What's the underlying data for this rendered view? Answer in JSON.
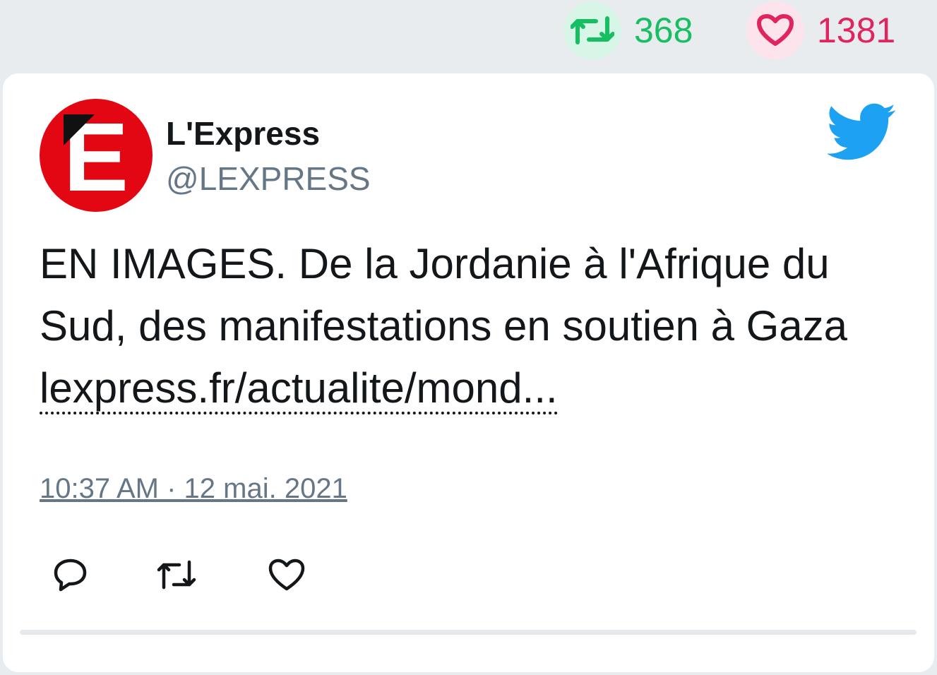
{
  "stats": {
    "retweet_count": "368",
    "like_count": "1381"
  },
  "tweet": {
    "author_name": "L'Express",
    "author_handle": "@LEXPRESS",
    "avatar_letter": "E",
    "text_before_link": "EN IMAGES. De la Jordanie à l'Afrique du Sud, des manifestations en soutien à Gaza ",
    "link_text": "lexpress.fr/actualite/mond...",
    "timestamp": "10:37 AM · 12 mai. 2021"
  },
  "colors": {
    "retweet_green": "#17bf63",
    "like_pink": "#e0245e",
    "twitter_blue": "#1da1f2",
    "avatar_red": "#e30613",
    "muted_gray": "#657786"
  },
  "icons": {
    "top_retweet": "retweet-icon",
    "top_like": "heart-icon",
    "brand": "twitter-bird-icon",
    "reply": "reply-icon",
    "retweet": "retweet-icon",
    "like": "heart-icon"
  }
}
